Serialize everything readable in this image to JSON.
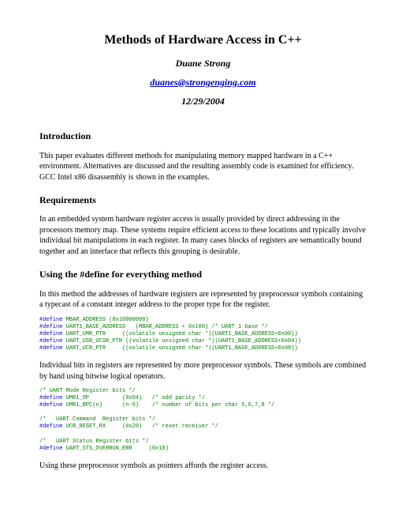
{
  "header": {
    "title": "Methods of Hardware Access in C++",
    "author": "Duane Strong",
    "email": "duanes@strongenging.com",
    "date": "12/29/2004"
  },
  "sections": {
    "intro": {
      "heading": "Introduction",
      "p1": "This paper evaluates different methods for manipulating memory mapped hardware in a C++ environment. Alternatives are discussed and the resulting assembly code is examined for efficiency. GCC Intel x86 disassembly is shown in the examples."
    },
    "req": {
      "heading": "Requirements",
      "p1": "In an embedded system hardware register access is usually provided by direct addressing in the processors memory map. These systems require efficient access to these locations and typically involve individual bit manipulations in each register. In many cases blocks of registers are semantically bound together and an interface that reflects this grouping is desirable."
    },
    "define": {
      "heading": "Using the #define for everything method",
      "p1": "In this method the addresses of hardware registers are represented by preprocessor symbols containing a typecast of a constant integer address to the proper type for the register.",
      "p2": "Individual bits in registers are represented by more preprocessor symbols. These symbols are combined by hand using bitwise logical operators.",
      "p3": "Using these preprocessor symbols as pointers affords the register access."
    }
  },
  "code": {
    "block1": {
      "l1a": "#define",
      "l1b": " MBAR_ADDRESS (0x10000000)",
      "l2a": "#define",
      "l2b": " UART1_BASE_ADDRESS   (MBAR_ADDRESS + 0x100) ",
      "l2c": "/* UART 1 base */",
      "l3a": "#define",
      "l3b": " UART_UMR_PTR     ((volatile unsigned char *)(UART1_BASE_ADDRESS+0x00))",
      "l4a": "#define",
      "l4b": " UART_USR_UCSR_PTR ((volatile unsigned char *)(UART1_BASE_ADDRESS+0x04))",
      "l5a": "#define",
      "l5b": " UART_UCR_PTR     ((volatile unsigned char *)(UART1_BASE_ADDRESS+0x08))"
    },
    "block2": {
      "l1": "/* UART Mode Register bits */",
      "l2a": "#define",
      "l2b": " UMR1_OP          (0x04)   ",
      "l2c": "/* odd parity */",
      "l3a": "#define",
      "l3b": " UMR1_BPC(n)      (n-5)    ",
      "l3c": "/* number of bits per char 5,6,7,8 */",
      "l4": "/*   UART Command  Register bits */",
      "l5a": "#define",
      "l5b": " UCR_RESET_RX     (0x20)   ",
      "l5c": "/* reset receiver */",
      "l6": "/*   UART Status Register bits */",
      "l7a": "#define",
      "l7b": " UART_STS_OVERRUN_ERR     (0x10)"
    }
  }
}
